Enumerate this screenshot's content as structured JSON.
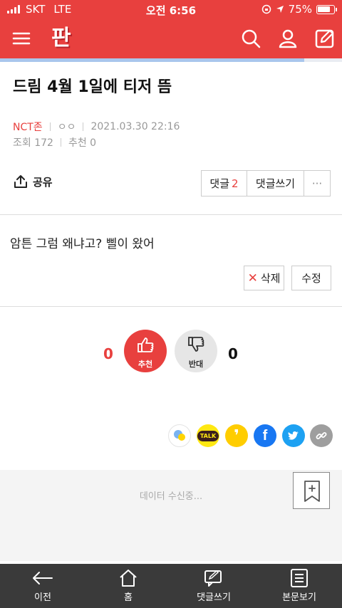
{
  "status": {
    "carrier": "SKT",
    "network": "LTE",
    "time": "오전 6:56",
    "battery": "75%"
  },
  "app": {
    "logo": "판",
    "menu_icon": "menu-icon",
    "search_icon": "search-icon",
    "user_icon": "user-icon",
    "write_icon": "edit-icon"
  },
  "progress": 0.89,
  "post": {
    "title": "드림 4월 1일에 티저 뜸",
    "category": "NCT존",
    "author": "ㅇㅇ",
    "datetime": "2021.03.30 22:16",
    "views": "조회 172",
    "recommend": "추천 0",
    "body": "암튼 그럼 왜냐고? 삘이 왔어"
  },
  "actions": {
    "share": "공유",
    "comments_label": "댓글",
    "comments_count": "2",
    "write_comment": "댓글쓰기",
    "more": "···",
    "delete": "삭제",
    "edit": "수정"
  },
  "vote": {
    "up_count": "0",
    "up_label": "추천",
    "down_label": "반대",
    "down_count": "0"
  },
  "social": [
    {
      "name": "kakaostory",
      "color": "#ffffff"
    },
    {
      "name": "kakaotalk",
      "label": "TALK",
      "color": "#ffe812"
    },
    {
      "name": "kakaopage",
      "label": "❜",
      "color": "#ffcd00"
    },
    {
      "name": "facebook",
      "label": "f",
      "color": "#1877f2"
    },
    {
      "name": "twitter",
      "color": "#1da1f2"
    },
    {
      "name": "link",
      "color": "#9e9e9e"
    }
  ],
  "loading": "데이터 수신중...",
  "bottom": {
    "back": "이전",
    "home": "홈",
    "comment": "댓글쓰기",
    "view": "본문보기"
  },
  "colors": {
    "brand": "#e8403e",
    "bottom_bar": "#3a3a3a"
  }
}
